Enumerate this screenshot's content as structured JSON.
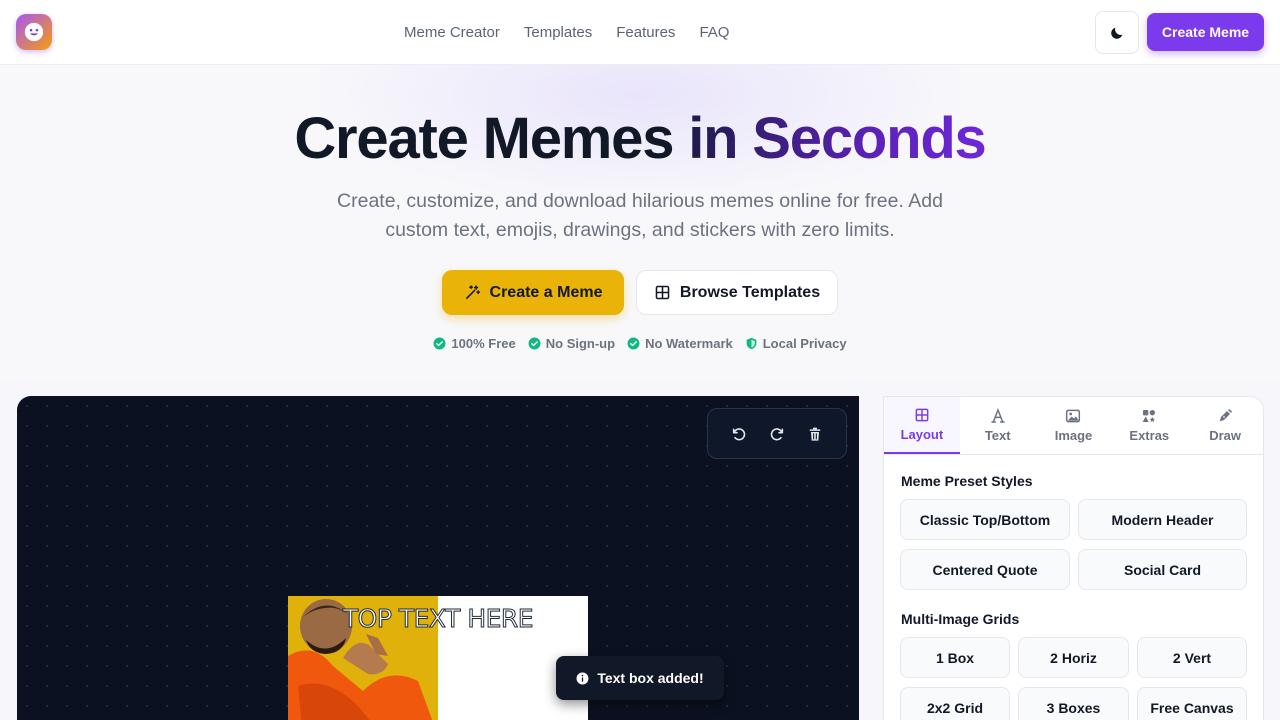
{
  "header": {
    "logo_icon": "smiley-face-icon",
    "nav": [
      "Meme Creator",
      "Templates",
      "Features",
      "FAQ"
    ],
    "theme_icon": "moon-icon",
    "create_label": "Create Meme"
  },
  "hero": {
    "title_part1": "Create Memes",
    "title_part2": "in Seconds",
    "subtitle": "Create, customize, and download hilarious memes online for free. Add custom text, emojis, drawings, and stickers with zero limits.",
    "cta_primary": "Create a Meme",
    "cta_secondary": "Browse Templates",
    "badges": [
      "100% Free",
      "No Sign-up",
      "No Watermark",
      "Local Privacy"
    ]
  },
  "editor": {
    "toolbar_icons": [
      "undo-icon",
      "redo-icon",
      "trash-icon"
    ],
    "meme_text": "TOP TEXT HERE",
    "toast": "Text box added!"
  },
  "panel": {
    "tabs": [
      "Layout",
      "Text",
      "Image",
      "Extras",
      "Draw"
    ],
    "active_tab": "Layout",
    "preset_title": "Meme Preset Styles",
    "presets": [
      "Classic Top/Bottom",
      "Modern Header",
      "Centered Quote",
      "Social Card"
    ],
    "grid_title": "Multi-Image Grids",
    "grids": [
      "1 Box",
      "2 Horiz",
      "2 Vert",
      "2x2 Grid",
      "3 Boxes",
      "Free Canvas"
    ]
  },
  "colors": {
    "accent": "#7c3aed",
    "cta": "#eab308",
    "canvas_bg": "#0b1120",
    "badge_check": "#10b981"
  }
}
